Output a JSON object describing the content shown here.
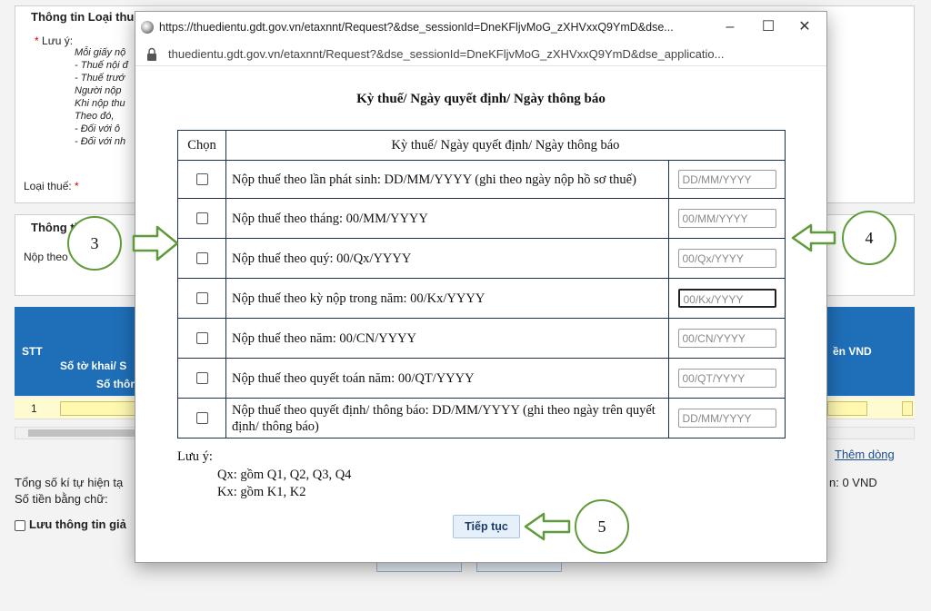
{
  "background": {
    "section1_title": "Thông tin Loại thuế",
    "note_label": "Lưu ý:",
    "note_lines": [
      "Mỗi giấy nộ",
      "- Thuế nội đ",
      "- Thuế trướ",
      "Người nộp",
      "Khi nộp thu",
      "Theo đó,",
      "- Đối với ô",
      "- Đối với nh"
    ],
    "tax_type_label": "Loại thuế:",
    "section2_title": "Thông tin...c:",
    "pay_per_label": "Nộp theo",
    "grid_headers": {
      "stt": "STT",
      "declaration": "Số tờ khai/ S",
      "notice": "Số thôn",
      "amount_vnd": "ền VND"
    },
    "row_number": "1",
    "add_row_link": "Thêm dòng",
    "total_label": "Tổng số kí tự hiện tạ",
    "amount_words_label": "Số tiền bằng chữ:",
    "total_amount": "n: 0 VND",
    "save_info_label": "Lưu thông tin giả"
  },
  "window": {
    "title": "https://thuedientu.gdt.gov.vn/etaxnnt/Request?&dse_sessionId=DneKFljvMoG_zXHVxxQ9YmD&dse...",
    "url": "thuedientu.gdt.gov.vn/etaxnnt/Request?&dse_sessionId=DneKFljvMoG_zXHVxxQ9YmD&dse_applicatio...",
    "minimize": "–",
    "maximize": "☐",
    "close": "✕"
  },
  "dialog": {
    "heading": "Kỳ thuế/ Ngày quyết định/ Ngày thông báo",
    "col_select": "Chọn",
    "col_period": "Kỳ thuế/ Ngày quyết định/ Ngày thông báo",
    "rows": [
      {
        "label": "Nộp thuế theo lần phát sinh: DD/MM/YYYY (ghi theo ngày nộp hồ sơ thuế)",
        "placeholder": "DD/MM/YYYY"
      },
      {
        "label": "Nộp thuế theo tháng: 00/MM/YYYY",
        "placeholder": "00/MM/YYYY"
      },
      {
        "label": "Nộp thuế theo quý: 00/Qx/YYYY",
        "placeholder": "00/Qx/YYYY"
      },
      {
        "label": "Nộp thuế theo kỳ nộp trong năm: 00/Kx/YYYY",
        "placeholder": "00/Kx/YYYY"
      },
      {
        "label": "Nộp thuế theo năm: 00/CN/YYYY",
        "placeholder": "00/CN/YYYY"
      },
      {
        "label": "Nộp thuế theo quyết toán năm: 00/QT/YYYY",
        "placeholder": "00/QT/YYYY"
      },
      {
        "label": "Nộp thuế theo quyết định/ thông báo: DD/MM/YYYY (ghi theo ngày trên quyết định/ thông báo)",
        "placeholder": "DD/MM/YYYY"
      }
    ],
    "note_title": "Lưu ý:",
    "note_qx": "Qx: gồm Q1, Q2, Q3, Q4",
    "note_kx": "Kx: gồm K1, K2",
    "continue_label": "Tiếp tục"
  },
  "annotations": {
    "step3": "3",
    "step4": "4",
    "step5": "5",
    "arrow_color": "#5f9b3a"
  }
}
